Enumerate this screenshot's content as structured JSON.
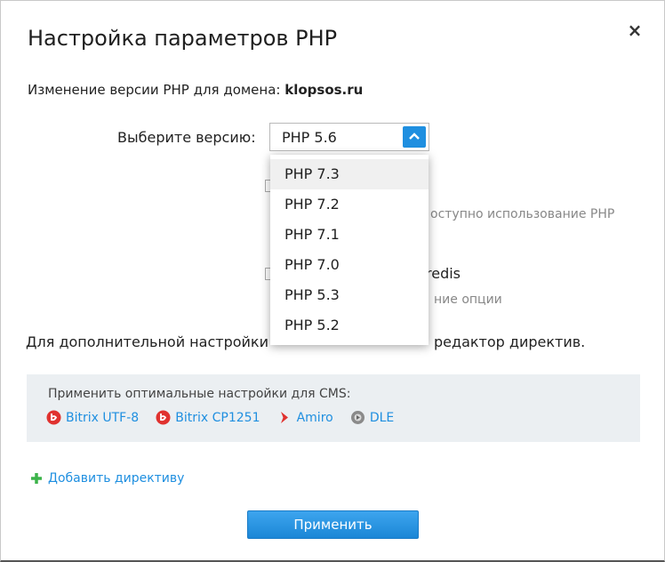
{
  "dialog": {
    "title": "Настройка параметров PHP",
    "subtitle_prefix": "Изменение версии PHP для домена: ",
    "domain": "klopsos.ru",
    "close_glyph": "×"
  },
  "version_select": {
    "label": "Выберите версию:",
    "selected": "PHP 5.6",
    "open": true,
    "options": [
      "PHP 7.3",
      "PHP 7.2",
      "PHP 7.1",
      "PHP 7.0",
      "PHP 5.3",
      "PHP 5.2"
    ],
    "highlighted_option": "PHP 7.3"
  },
  "options_partial": {
    "text1_partial": "оступно использование PHP",
    "text2_partial": "redis",
    "text3_partial": "ние опции"
  },
  "directives": {
    "text_before": "Для дополнительной настройки",
    "text_after": "редактор директив."
  },
  "cms": {
    "title": "Применить оптимальные настройки для CMS:",
    "links": [
      {
        "label": "Bitrix UTF-8",
        "icon": "bitrix-icon"
      },
      {
        "label": "Bitrix CP1251",
        "icon": "bitrix-icon"
      },
      {
        "label": "Amiro",
        "icon": "amiro-icon"
      },
      {
        "label": "DLE",
        "icon": "dle-icon"
      }
    ]
  },
  "add_directive": {
    "label": "Добавить директиву",
    "icon": "plus-icon"
  },
  "apply_button": {
    "label": "Применить"
  },
  "colors": {
    "accent": "#1f8fe0",
    "plus": "#3cb34a",
    "bitrix": "#e0322f",
    "amiro": "#e0322f"
  }
}
